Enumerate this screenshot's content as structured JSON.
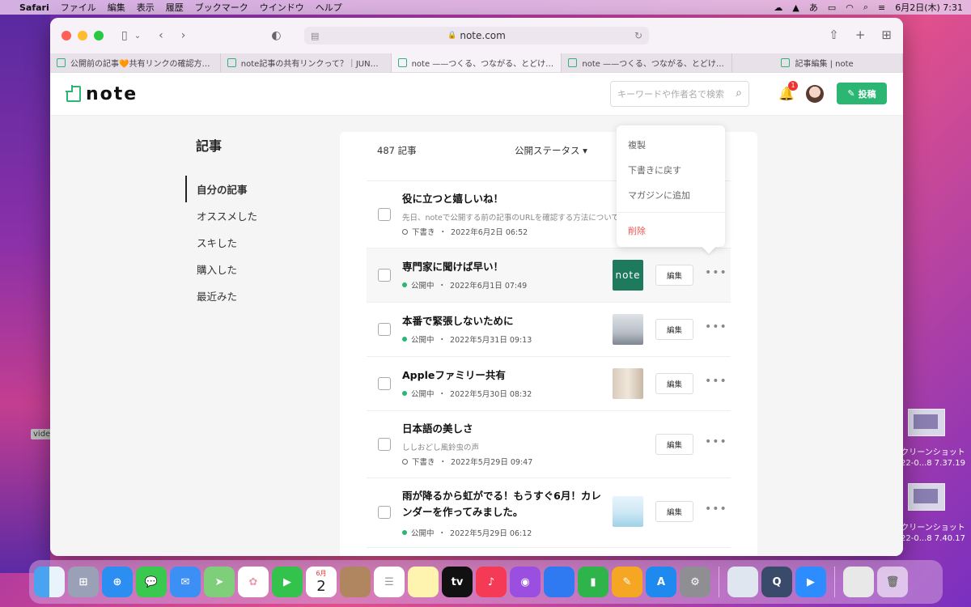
{
  "menubar": {
    "app": "Safari",
    "items": [
      "ファイル",
      "編集",
      "表示",
      "履歴",
      "ブックマーク",
      "ウインドウ",
      "ヘルプ"
    ],
    "ime": "あ",
    "datetime": "6月2日(木)  7:31"
  },
  "desktop": {
    "left_label": "vide",
    "files": [
      {
        "caption1": "クリーンショット",
        "caption2": "22-0...8 7.37.19"
      },
      {
        "caption1": "クリーンショット",
        "caption2": "22-0...8 7.40.17"
      }
    ]
  },
  "browser": {
    "url": "note.com",
    "tabs": [
      {
        "title": "公開前の記事🧡共有リンクの確認方法…",
        "active": false
      },
      {
        "title": "note記事の共有リンクって？｜JUN…",
        "active": false
      },
      {
        "title": "note ——つくる、つながる、とどける。",
        "active": true
      },
      {
        "title": "note ——つくる、つながる、とどける。",
        "active": false
      },
      {
        "title": "記事編集 | note",
        "active": false
      }
    ]
  },
  "note": {
    "logo": "note",
    "search_placeholder": "キーワードや作者名で検索",
    "notification_count": "1",
    "post_button": "投稿",
    "sidebar": {
      "title": "記事",
      "items": [
        "自分の記事",
        "オススメした",
        "スキした",
        "購入した",
        "最近みた"
      ]
    },
    "list": {
      "count": "487 記事",
      "status_filter": "公開ステータス",
      "edit_label": "編集",
      "articles": [
        {
          "title": "役に立つと嬉しいね！",
          "excerpt": "先日、noteで公開する前の記事のURLを確認する方法についての",
          "status": "下書き",
          "date": "2022年6月2日 06:52"
        },
        {
          "title": "専門家に聞けば早い！",
          "excerpt": "",
          "status": "公開中",
          "date": "2022年6月1日 07:49",
          "thumb_text": "note"
        },
        {
          "title": "本番で緊張しないために",
          "excerpt": "",
          "status": "公開中",
          "date": "2022年5月31日 09:13"
        },
        {
          "title": "Appleファミリー共有",
          "excerpt": "",
          "status": "公開中",
          "date": "2022年5月30日 08:32"
        },
        {
          "title": "日本語の美しさ",
          "excerpt": "ししおどし風鈴虫の声",
          "status": "下書き",
          "date": "2022年5月29日 09:47"
        },
        {
          "title": "雨が降るから虹がでる！もうすぐ6月！カレンダーを作ってみました。",
          "excerpt": "",
          "status": "公開中",
          "date": "2022年5月29日 06:12"
        }
      ]
    },
    "context_menu": {
      "items": [
        "複製",
        "下書きに戻す",
        "マガジンに追加"
      ],
      "danger_item": "削除"
    }
  },
  "dock": {
    "calendar_month": "6月",
    "calendar_day": "2",
    "apps": [
      "finder-icon",
      "launchpad-icon",
      "safari-icon",
      "messages-icon",
      "mail-icon",
      "maps-icon",
      "photos-icon",
      "facetime-icon",
      "calendar-icon",
      "contacts-icon",
      "reminders-icon",
      "notes-icon",
      "tv-icon",
      "music-icon",
      "podcasts-icon",
      "keynote-icon",
      "numbers-icon",
      "pages-icon",
      "appstore-icon",
      "settings-icon",
      "preview-icon",
      "quicktime-icon",
      "zoom-icon",
      "downloads-icon",
      "trash-icon"
    ],
    "tv_label": "tv"
  }
}
